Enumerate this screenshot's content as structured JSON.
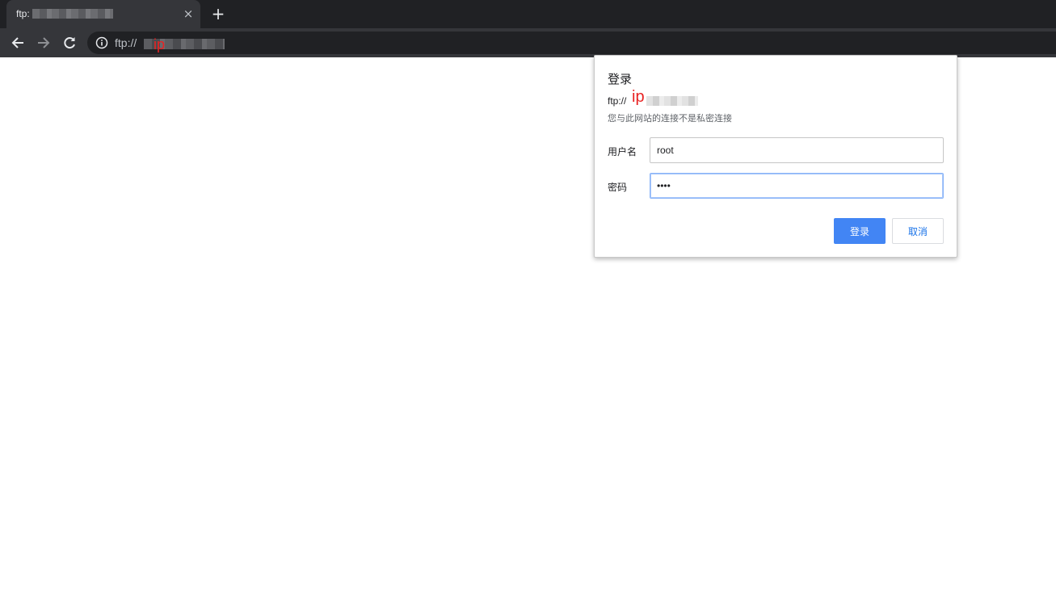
{
  "tab": {
    "title": "ftp:",
    "close_glyph": "×",
    "new_tab_glyph": "+"
  },
  "toolbar": {
    "back_icon": "arrow-left-icon",
    "forward_icon": "arrow-right-icon",
    "reload_icon": "reload-icon",
    "url_prefix": "ftp://",
    "url_annotation": "ip"
  },
  "dialog": {
    "title": "登录",
    "origin_prefix": "ftp://",
    "origin_annotation": "ip",
    "warning": "您与此网站的连接不是私密连接",
    "username_label": "用户名",
    "username_value": "root",
    "password_label": "密码",
    "password_value": "xxxx",
    "login_button": "登录",
    "cancel_button": "取消"
  },
  "colors": {
    "accent": "#4285f4",
    "annotation": "#e82222",
    "tabstrip": "#202124",
    "toolbar": "#35363a"
  }
}
